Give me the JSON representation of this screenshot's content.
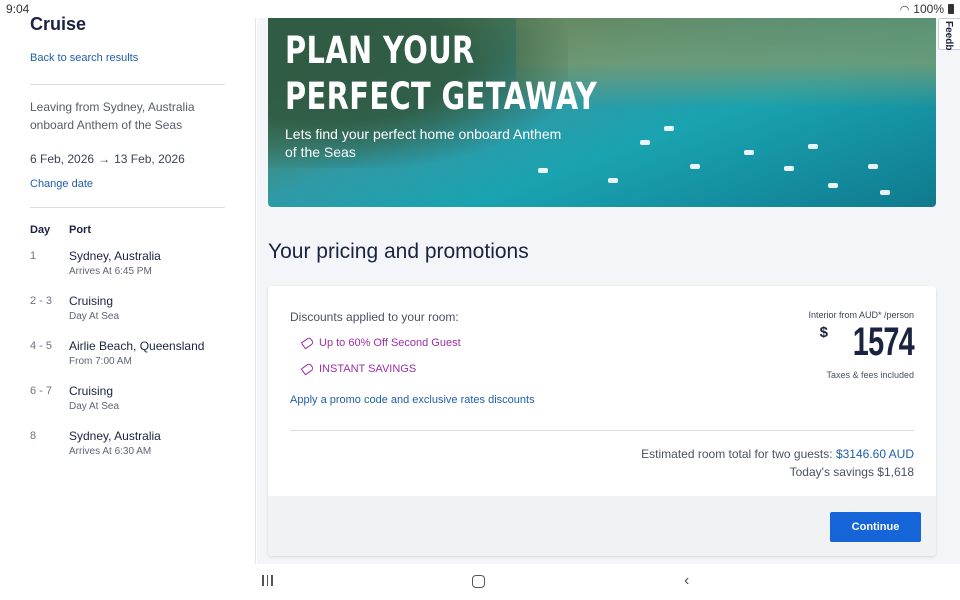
{
  "status_bar": {
    "time": "9:04",
    "battery": "100%"
  },
  "sidebar": {
    "title": "Cruise",
    "back_link": "Back to search results",
    "leaving": "Leaving from Sydney, Australia onboard Anthem of the Seas",
    "date_start": "6 Feb, 2026",
    "date_end": "13 Feb, 2026",
    "change_date": "Change date",
    "itinerary_headers": {
      "day": "Day",
      "port": "Port"
    },
    "itinerary": [
      {
        "day": "1",
        "port": "Sydney, Australia",
        "detail": "Arrives At 6:45 PM"
      },
      {
        "day": "2 - 3",
        "port": "Cruising",
        "detail": "Day At Sea"
      },
      {
        "day": "4 - 5",
        "port": "Airlie Beach, Queensland",
        "detail": "From 7:00 AM"
      },
      {
        "day": "6 - 7",
        "port": "Cruising",
        "detail": "Day At Sea"
      },
      {
        "day": "8",
        "port": "Sydney, Australia",
        "detail": "Arrives At 6:30 AM"
      }
    ]
  },
  "hero": {
    "title_line1": "PLAN YOUR",
    "title_line2": "PERFECT GETAWAY",
    "subtitle": "Lets find your perfect home onboard Anthem of the Seas"
  },
  "feedback": "Feedb",
  "pricing": {
    "section_title": "Your pricing and promotions",
    "discounts_label": "Discounts applied to your room:",
    "promos": [
      "Up to 60% Off Second Guest",
      "INSTANT SAVINGS"
    ],
    "promo_link": "Apply a promo code and exclusive rates discounts",
    "price_label": "Interior from AUD* /person",
    "currency_symbol": "$",
    "price": "1574",
    "taxes": "Taxes & fees included",
    "estimated_label": "Estimated room total for two guests:",
    "estimated_amount": "$3146.60 AUD",
    "savings": "Today's savings $1,618",
    "continue": "Continue"
  },
  "colors": {
    "accent": "#1565d8",
    "link": "#1f5fa8",
    "promo": "#9b2fa8",
    "heading": "#1a2340"
  }
}
